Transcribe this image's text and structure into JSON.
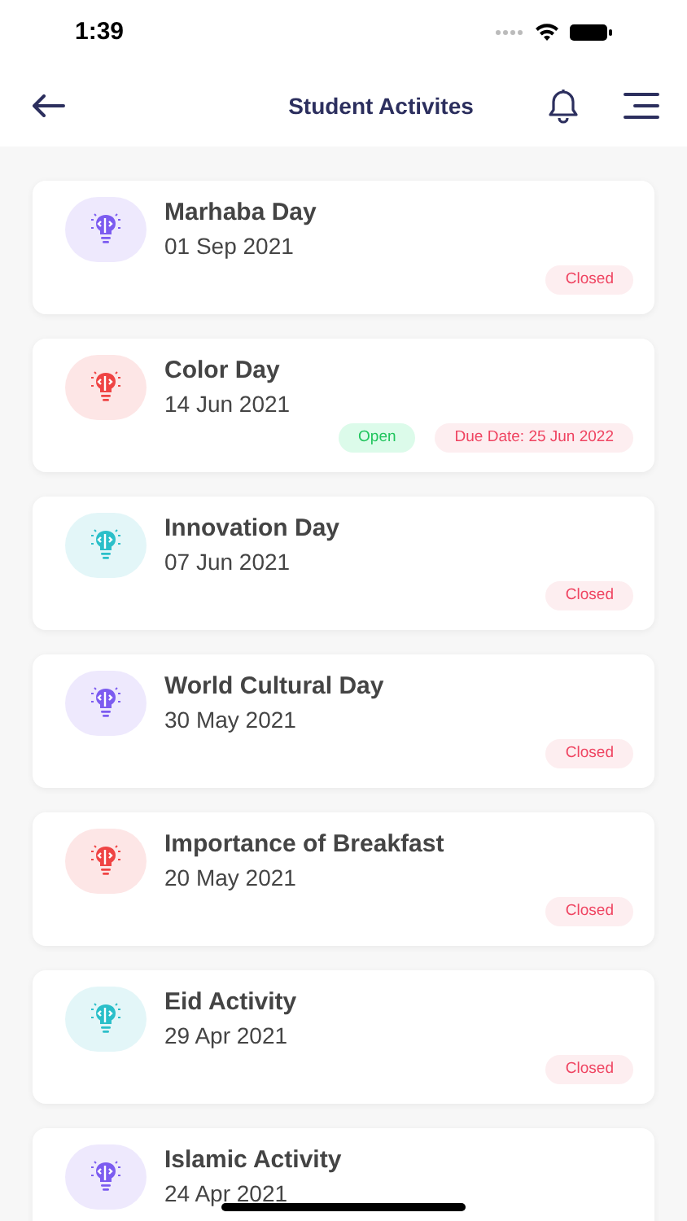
{
  "status_bar": {
    "time": "1:39"
  },
  "header": {
    "title": "Student Activites"
  },
  "activities": [
    {
      "title": "Marhaba Day",
      "date": "01 Sep 2021",
      "color": "#7c5cf0",
      "badges": [
        {
          "kind": "closed",
          "text": "Closed"
        }
      ]
    },
    {
      "title": "Color Day",
      "date": "14 Jun 2021",
      "color": "#ef4444",
      "badges": [
        {
          "kind": "open",
          "text": "Open"
        },
        {
          "kind": "due",
          "text": "Due Date: 25 Jun 2022"
        }
      ]
    },
    {
      "title": "Innovation Day",
      "date": "07 Jun 2021",
      "color": "#2bbfc9",
      "badges": [
        {
          "kind": "closed",
          "text": "Closed"
        }
      ]
    },
    {
      "title": "World Cultural Day",
      "date": "30 May 2021",
      "color": "#7c5cf0",
      "badges": [
        {
          "kind": "closed",
          "text": "Closed"
        }
      ]
    },
    {
      "title": "Importance of Breakfast",
      "date": "20 May 2021",
      "color": "#ef4444",
      "badges": [
        {
          "kind": "closed",
          "text": "Closed"
        }
      ]
    },
    {
      "title": "Eid Activity",
      "date": "29 Apr 2021",
      "color": "#2bbfc9",
      "badges": [
        {
          "kind": "closed",
          "text": "Closed"
        }
      ]
    },
    {
      "title": "Islamic Activity",
      "date": "24 Apr 2021",
      "color": "#7c5cf0"
    }
  ]
}
